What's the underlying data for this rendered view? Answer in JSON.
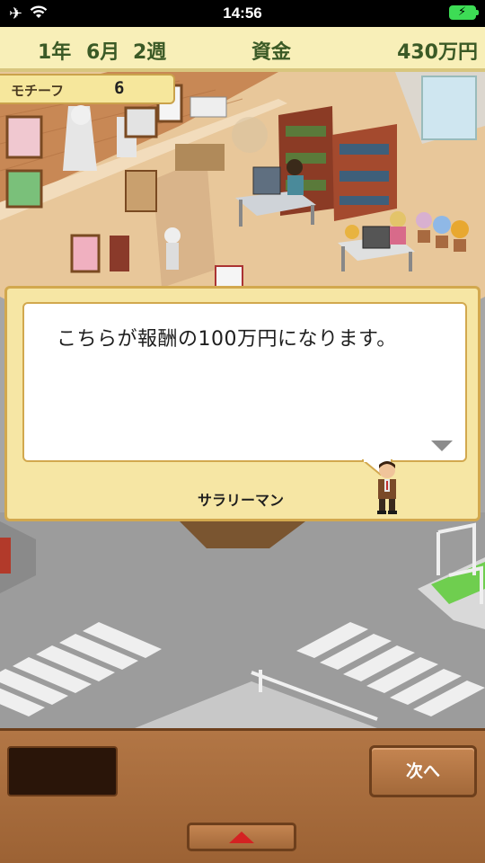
{
  "status_bar": {
    "time": "14:56",
    "airplane_icon": "airplane-icon",
    "wifi_icon": "wifi-icon",
    "battery_icon": "battery-charging-icon",
    "battery_color": "#3ddc55"
  },
  "header": {
    "year": "1年",
    "month": "6月",
    "week": "2週",
    "funds_label": "資金",
    "funds_value": "430万円"
  },
  "motif": {
    "label": "モチーフ",
    "value": "6"
  },
  "dialog": {
    "text": "こちらが報酬の100万円になります。",
    "speaker": "サラリーマン",
    "more_icon": "down-triangle-icon"
  },
  "bottom_bar": {
    "next_label": "次へ",
    "up_icon": "up-triangle-icon"
  },
  "colors": {
    "header_bg": "#f8efb8",
    "header_text": "#3b5a26",
    "dialog_bg": "#f6e6a4",
    "dialog_border": "#d2a84e",
    "bottom_bar": "#b27645",
    "up_arrow": "#d42222"
  }
}
